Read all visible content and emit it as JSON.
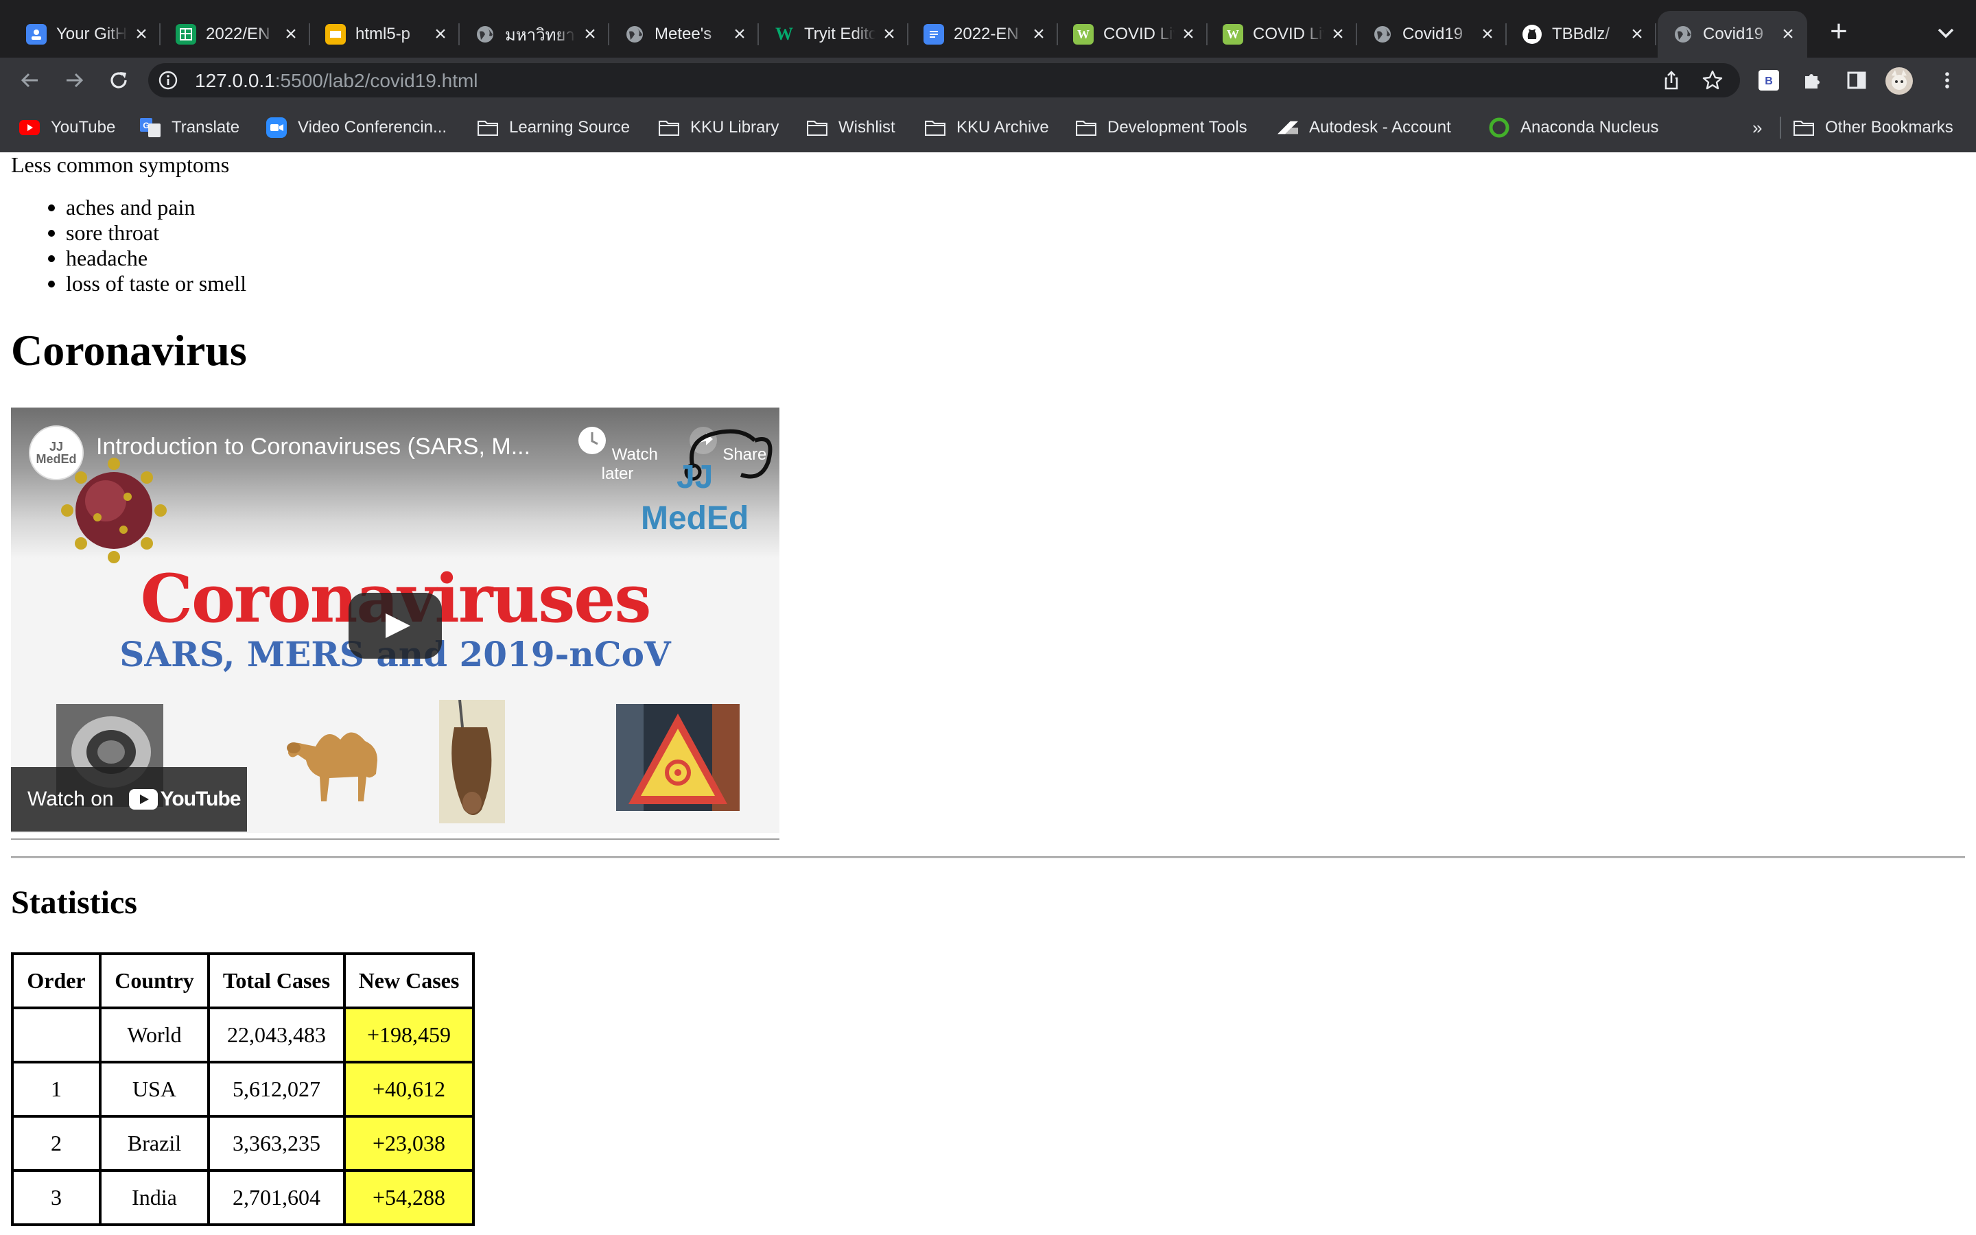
{
  "browser": {
    "tabs": [
      {
        "title": "Your GitHub",
        "favicon_color": "#4285f4",
        "favicon_icon": "classroom-icon",
        "active": false
      },
      {
        "title": "2022/EN",
        "favicon_color": "#0f9d58",
        "favicon_icon": "sheets-icon",
        "active": false
      },
      {
        "title": "html5-p",
        "favicon_color": "#f4b400",
        "favicon_icon": "slides-icon",
        "active": false
      },
      {
        "title": "มหาวิทยาลัย",
        "favicon_color": "#9aa0a6",
        "favicon_icon": "globe-icon",
        "active": false
      },
      {
        "title": "Metee's",
        "favicon_color": "#9aa0a6",
        "favicon_icon": "globe-icon",
        "active": false
      },
      {
        "title": "Tryit Editor",
        "favicon_color": "#04aa6d",
        "favicon_icon": "w3schools-icon",
        "active": false
      },
      {
        "title": "2022-EN",
        "favicon_color": "#4285f4",
        "favicon_icon": "docs-icon",
        "active": false
      },
      {
        "title": "COVID Live",
        "favicon_color": "#8bc34a",
        "favicon_icon": "worldometer-icon",
        "active": false
      },
      {
        "title": "COVID Live",
        "favicon_color": "#8bc34a",
        "favicon_icon": "worldometer-icon",
        "active": false
      },
      {
        "title": "Covid19",
        "favicon_color": "#9aa0a6",
        "favicon_icon": "globe-icon",
        "active": false
      },
      {
        "title": "TBBdlz/",
        "favicon_color": "#ffffff",
        "favicon_icon": "github-icon",
        "active": false
      },
      {
        "title": "Covid19",
        "favicon_color": "#9aa0a6",
        "favicon_icon": "globe-icon",
        "active": true
      }
    ],
    "address": {
      "host": "127.0.0.1",
      "path": ":5500/lab2/covid19.html"
    },
    "bookmarks": [
      {
        "label": "YouTube",
        "icon": "youtube-icon",
        "color": "#ff0000"
      },
      {
        "label": "Translate",
        "icon": "translate-icon",
        "color": "#4285f4"
      },
      {
        "label": "Video Conferencin...",
        "icon": "zoom-icon",
        "color": "#2d8cff"
      },
      {
        "label": "Learning Source",
        "icon": "folder-icon",
        "color": "#e8eaed"
      },
      {
        "label": "KKU Library",
        "icon": "folder-icon",
        "color": "#e8eaed"
      },
      {
        "label": "Wishlist",
        "icon": "folder-icon",
        "color": "#e8eaed"
      },
      {
        "label": "KKU Archive",
        "icon": "folder-icon",
        "color": "#e8eaed"
      },
      {
        "label": "Development Tools",
        "icon": "folder-icon",
        "color": "#e8eaed"
      },
      {
        "label": "Autodesk - Account",
        "icon": "autodesk-icon",
        "color": "#ffffff"
      },
      {
        "label": "Anaconda Nucleus",
        "icon": "anaconda-icon",
        "color": "#43b02a"
      }
    ],
    "overflow_label": "»",
    "other_bookmarks": "Other Bookmarks",
    "profile_initial": "B"
  },
  "page": {
    "less_common_title": "Less common symptoms",
    "symptoms": [
      "aches and pain",
      "sore throat",
      "headache",
      "loss of taste or smell"
    ],
    "coronavirus_heading": "Coronavirus",
    "video": {
      "channel_label": "JJ MedEd",
      "title": "Introduction to Coronaviruses (SARS, M...",
      "watch_later": "Watch later",
      "share": "Share",
      "brand_line1": "JJ",
      "brand_line2": "MedEd",
      "big_title": "Coronaviruses",
      "sub_title": "SARS, MERS and 2019-nCoV",
      "watch_on": "Watch on",
      "youtube_logo": "YouTube"
    },
    "statistics_heading": "Statistics",
    "table": {
      "headers": [
        "Order",
        "Country",
        "Total Cases",
        "New Cases"
      ],
      "rows": [
        {
          "order": "",
          "country": "World",
          "total": "22,043,483",
          "new": "+198,459"
        },
        {
          "order": "1",
          "country": "USA",
          "total": "5,612,027",
          "new": "+40,612"
        },
        {
          "order": "2",
          "country": "Brazil",
          "total": "3,363,235",
          "new": "+23,038"
        },
        {
          "order": "3",
          "country": "India",
          "total": "2,701,604",
          "new": "+54,288"
        }
      ],
      "new_cases_highlight": "#ffff44"
    }
  }
}
